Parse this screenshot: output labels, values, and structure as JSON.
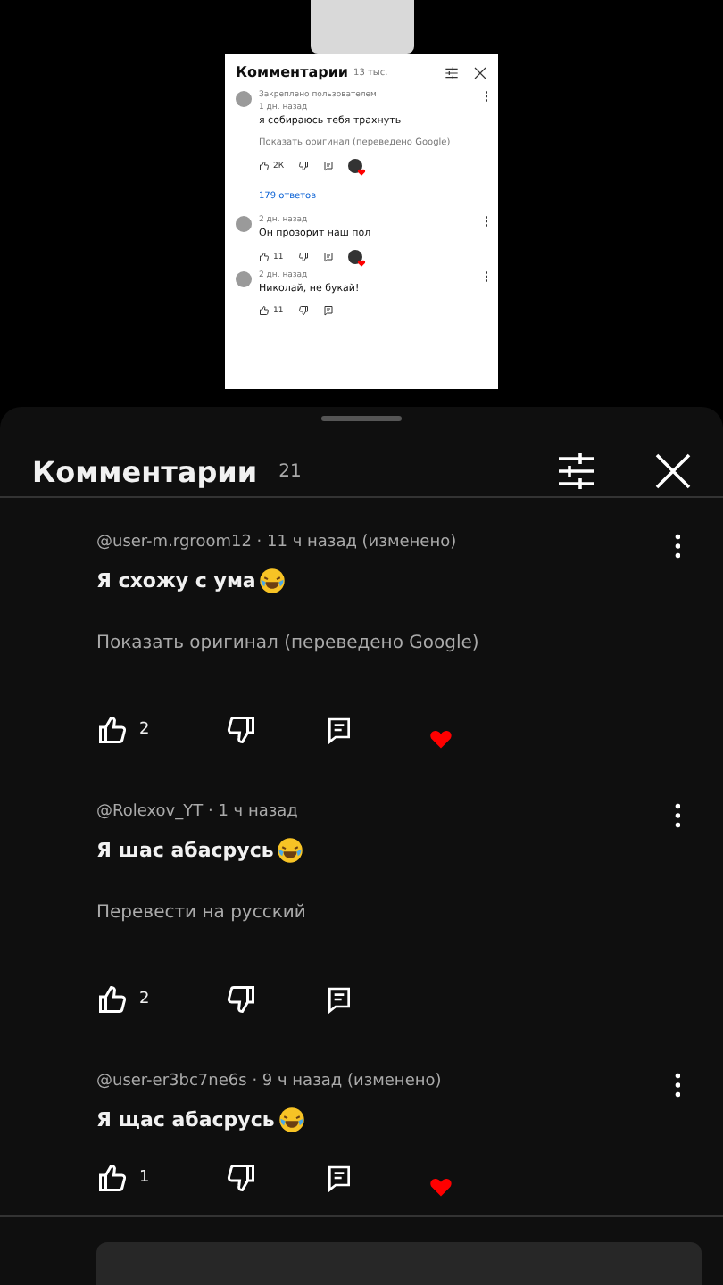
{
  "preview": {
    "title": "Комментарии",
    "count": "13 тыс.",
    "pinned_label": "Закреплено пользователем",
    "comments": [
      {
        "meta": "1 дн. назад",
        "text": "я собираюсь тебя трахнуть",
        "translate": "Показать оригинал (переведено Google)",
        "likes": "2К",
        "hearted": true,
        "pinned": true,
        "replies": "179 ответов"
      },
      {
        "meta": "2 дн. назад",
        "text": "Он прозорит наш пол",
        "likes": "11",
        "hearted": true,
        "pinned": false
      },
      {
        "meta": "2 дн. назад",
        "text": "Николай, не букай!",
        "likes": "11",
        "hearted": false,
        "pinned": false
      }
    ]
  },
  "sheet": {
    "title": "Комментарии",
    "count": "21",
    "comments": [
      {
        "author": "@user-m.rgroom12",
        "meta": "· 11 ч назад (изменено)",
        "text": "Я схожу с ума",
        "kind": "with_emoji",
        "translate": "Показать оригинал (переведено Google)",
        "likes": "2",
        "hearted": true
      },
      {
        "author": "@Rolexov_YT",
        "meta": "· 1 ч назад",
        "text": "Я шас абасрусь",
        "kind": "with_emoji",
        "translate": "Перевести на русский",
        "likes": "2",
        "hearted": false
      },
      {
        "author": "@user-er3bc7ne6s",
        "meta": "· 9 ч назад (изменено)",
        "text": "Я щас абасрусь",
        "kind": "with_emoji",
        "likes": "1",
        "hearted": true
      }
    ]
  }
}
